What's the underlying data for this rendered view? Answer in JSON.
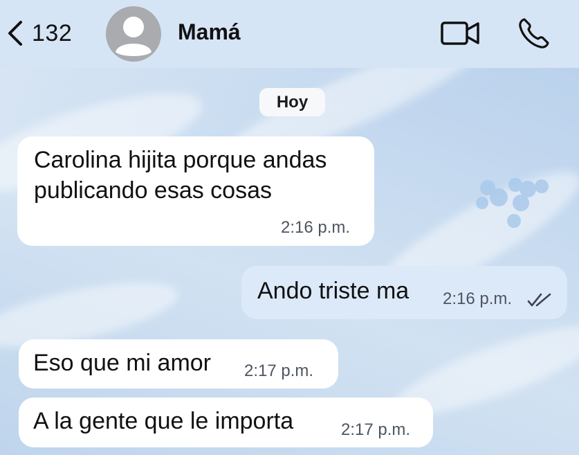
{
  "header": {
    "back_count": "132",
    "contact_name": "Mamá",
    "icons": [
      "chevron-left-icon",
      "avatar-placeholder-icon",
      "video-camera-icon",
      "phone-icon"
    ]
  },
  "date_chip": "Hoy",
  "messages": [
    {
      "direction": "incoming",
      "lines": [
        "Carolina hijita porque andas",
        "publicando esas cosas"
      ],
      "time": "2:16 p.m."
    },
    {
      "direction": "outgoing",
      "text": "Ando triste ma",
      "time": "2:16 p.m.",
      "status_icon": "double-check-icon"
    },
    {
      "direction": "incoming",
      "text": "Eso que mi amor",
      "time": "2:17 p.m."
    },
    {
      "direction": "incoming",
      "text": "A la gente que le importa",
      "time": "2:17 p.m."
    }
  ],
  "colors": {
    "header_bg": "#d6e5f5",
    "wallpaper": "#c9ddf0",
    "incoming_bubble": "#ffffff",
    "outgoing_bubble": "#dce9f8",
    "timestamp": "#4e5561",
    "avatar": "#a9abaf",
    "sticker_blob": "#a9c9ea"
  }
}
